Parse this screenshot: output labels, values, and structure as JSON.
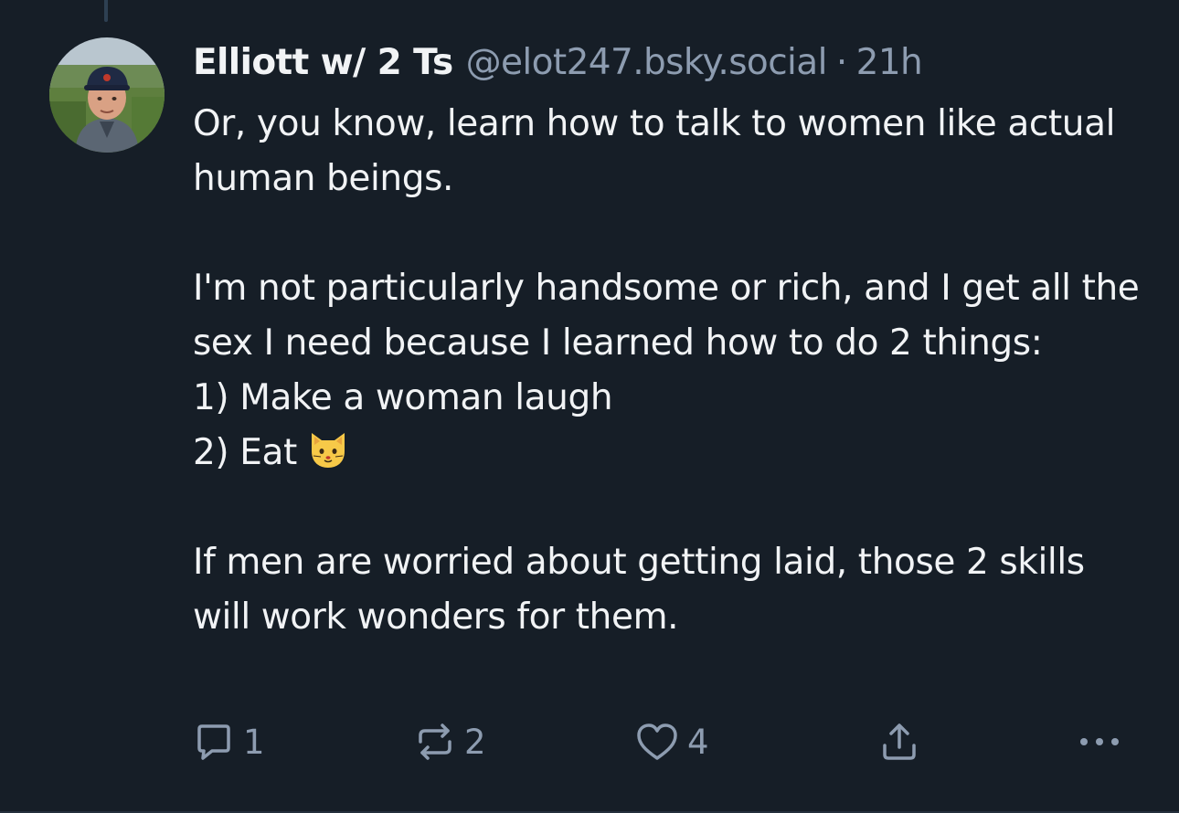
{
  "post": {
    "author": {
      "display_name": "Elliott w/ 2 Ts",
      "handle": "@elot247.bsky.social"
    },
    "separator": "·",
    "time_ago": "21h",
    "body": {
      "para1": "Or, you know, learn how to talk to women like actual human beings.",
      "para2_line1": "I'm not particularly handsome or rich, and I get all the sex I need because I learned how to do 2 things:",
      "list_item1": "1) Make a woman laugh",
      "list_item2": "2) Eat",
      "list_item2_emoji": "cat-face-emoji",
      "para3": "If men are worried about getting laid, those 2 skills will work wonders for them."
    },
    "actions": {
      "reply_count": "1",
      "repost_count": "2",
      "like_count": "4",
      "icons": [
        "reply-icon",
        "repost-icon",
        "like-icon",
        "share-icon",
        "more-icon"
      ]
    }
  },
  "colors": {
    "background": "#161e27",
    "text_primary": "#f1f3f5",
    "text_secondary": "#8d9cb0",
    "thread_line": "#2e4052"
  }
}
